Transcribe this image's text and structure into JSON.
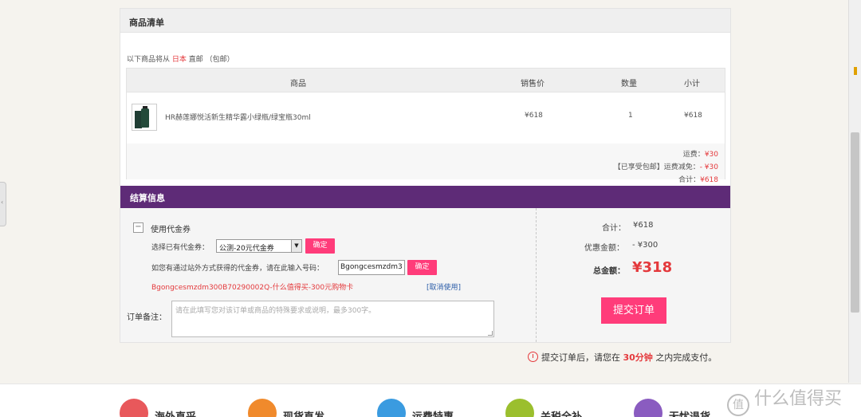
{
  "product_list": {
    "title": "商品清单",
    "ship_note_prefix": "以下商品将从",
    "ship_origin": "日本",
    "ship_note_suffix": "直邮 （包邮）",
    "columns": [
      "商品",
      "销售价",
      "数量",
      "小计"
    ],
    "items": [
      {
        "name": "HR赫莲娜悦活新生精华露小绿瓶/绿宝瓶30ml",
        "price": "¥618",
        "qty": "1",
        "subtotal": "¥618"
      }
    ],
    "shipping_label": "运费：",
    "shipping_value": "¥30",
    "free_ship_label": "【已享受包邮】运费减免：",
    "free_ship_value": "- ¥30",
    "total_label": "合计：",
    "total_value": "¥618"
  },
  "checkout": {
    "title": "结算信息",
    "use_coupon": "使用代金券",
    "select_label": "选择已有代金券：",
    "select_value": "公测-20元代金券",
    "confirm": "确定",
    "code_prompt": "如您有通过站外方式获得的代金券，请在此输入号码：",
    "code_value": "Bgongcesmzdm3",
    "applied_coupon": "Bgongcesmzdm300B70290002Q-什么值得买-300元购物卡",
    "cancel_use": "[取消使用]",
    "note_label": "订单备注：",
    "note_placeholder": "请在此填写您对该订单或商品的特殊要求或说明，最多300字。",
    "sum_label": "合计：",
    "sum_value": "¥618",
    "discount_label": "优惠金额：",
    "discount_value": "- ¥300",
    "grand_label": "总金额：",
    "grand_value": "¥318",
    "submit": "提交订单"
  },
  "deadline": {
    "prefix": "提交订单后，请您在",
    "time": "30分钟",
    "suffix": "之内完成支付。"
  },
  "footer": {
    "features": [
      {
        "label": "海外直采",
        "color": "#e8585b"
      },
      {
        "label": "现货直发",
        "color": "#f08a2c"
      },
      {
        "label": "运费特惠",
        "color": "#3a9be0"
      },
      {
        "label": "关税全补",
        "color": "#9bbf2e"
      },
      {
        "label": "无忧退货",
        "color": "#8a5cc0"
      }
    ],
    "watermark": "什么值得买"
  }
}
